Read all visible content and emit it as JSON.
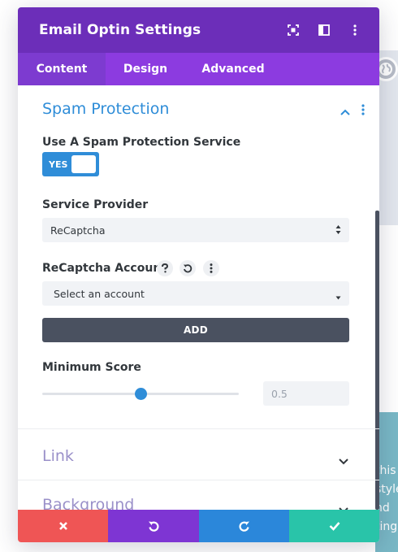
{
  "header": {
    "title": "Email Optin Settings"
  },
  "tabs": [
    {
      "label": "Content",
      "active": true
    },
    {
      "label": "Design",
      "active": false
    },
    {
      "label": "Advanced",
      "active": false
    }
  ],
  "section": {
    "title": "Spam Protection",
    "use_service_label": "Use A Spam Protection Service",
    "toggle_text": "YES",
    "provider_label": "Service Provider",
    "provider_value": "ReCaptcha",
    "account_label": "ReCaptcha Account",
    "account_placeholder": "Select an account",
    "add_label": "ADD",
    "min_score_label": "Minimum Score",
    "min_score_value": "0.5",
    "min_score_fraction": 0.5
  },
  "collapsed_sections": [
    {
      "label": "Link"
    },
    {
      "label": "Background"
    }
  ],
  "background": {
    "teal_text_lines": [
      "this",
      "style",
      "nd",
      "ting"
    ]
  },
  "colors": {
    "header": "#6c2eb9",
    "tabs": "#8c3be0",
    "accent_blue": "#2f8dd8",
    "cancel": "#ef5555",
    "undo": "#7e35d3",
    "redo": "#2b87da",
    "save": "#29c4a9"
  },
  "icons": {
    "header": [
      "fullscreen-icon",
      "split-view-icon",
      "more-icon"
    ],
    "account": [
      "help-icon",
      "reset-icon",
      "more-icon"
    ],
    "footer": [
      "close-icon",
      "undo-icon",
      "redo-icon",
      "check-icon"
    ]
  }
}
